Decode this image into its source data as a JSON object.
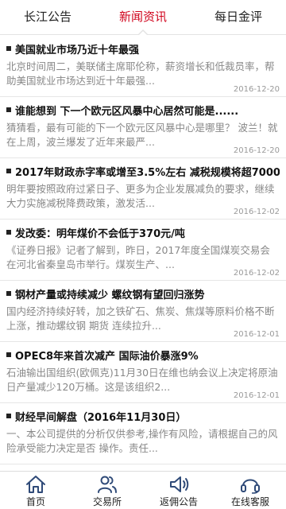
{
  "tabs": [
    {
      "label": "长江公告",
      "active": false
    },
    {
      "label": "新闻资讯",
      "active": true
    },
    {
      "label": "每日金评",
      "active": false
    }
  ],
  "articles": [
    {
      "title": "美国就业市场乃近十年最强",
      "summary": "北京时间周二，美联储主席耶伦称，薪资增长和低裁员率，帮助美国就业市场达到近十年最强...",
      "date": "2016-12-20"
    },
    {
      "title": "谁能想到 下一个欧元区风暴中心居然可能是......",
      "summary": "猜猜看，最有可能的下一个欧元区风暴中心是哪里？ 波兰！就在上周，波兰爆发了近年来最严...",
      "date": "2016-12-20"
    },
    {
      "title": "2017年财政赤字率或增至3.5%左右 减税规模将超7000亿",
      "summary": "明年要按照政府过紧日子、更多为企业发展减负的要求，继续大力实施减税降费政策，激发活...",
      "date": "2016-12-02"
    },
    {
      "title": "发改委：明年煤价不会低于370元/吨",
      "summary": "《证券日报》记者了解到，昨日，2017年度全国煤炭交易会在河北省秦皇岛市举行。煤炭生产、...",
      "date": "2016-12-02"
    },
    {
      "title": "钢材产量或持续减少 螺纹钢有望回归涨势",
      "summary": "国内经济持续好转，加之铁矿石、焦炭、焦煤等原料价格不断上涨，推动螺纹钢 期货 连续拉升...",
      "date": "2016-12-01"
    },
    {
      "title": "OPEC8年来首次减产 国际油价暴涨9%",
      "summary": "石油输出国组织(欧佩克)11月30日在维也纳会议上决定将原油日产量减少120万桶。这是该组织2...",
      "date": "2016-12-01"
    },
    {
      "title": "财经早间解盘（2016年11月30日）",
      "summary": "一、本公司提供的分析仅供参考,操作有风险，请根据自己的风险承受能力决定是否 操作。责任...",
      "date": ""
    }
  ],
  "bottom_nav": [
    {
      "label": "首页",
      "icon": "home-icon"
    },
    {
      "label": "交易所",
      "icon": "users-icon"
    },
    {
      "label": "返佣公告",
      "icon": "megaphone-icon"
    },
    {
      "label": "在线客服",
      "icon": "headset-icon"
    }
  ],
  "colors": {
    "accent": "#d0021b",
    "icon": "#2f4a78"
  }
}
